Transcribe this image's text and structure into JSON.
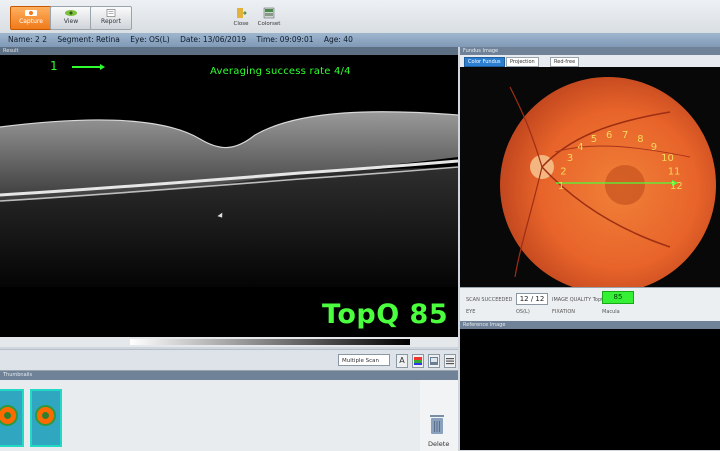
{
  "toolbar": {
    "capture_label": "Capture",
    "view_label": "View",
    "report_label": "Report",
    "close_label": "Close",
    "colorset_label": "Colorset"
  },
  "patient": {
    "name": "Name: 2 2",
    "segment": "Segment: Retina",
    "eye": "Eye: OS(L)",
    "date": "Date: 13/06/2019",
    "time": "Time: 09:09:01",
    "age": "Age: 40"
  },
  "oct": {
    "caption": "Result",
    "scan_index": "1",
    "averaging": "Averaging success rate  4/4",
    "topq": "TopQ 85"
  },
  "tools": {
    "scan_mode": "Multiple Scan",
    "text_tool": "A"
  },
  "thumbnails": {
    "caption": "Thumbnails",
    "delete_label": "Delete"
  },
  "fundus": {
    "caption": "Fundus Image",
    "tabs": [
      "Color Fundus",
      "Projection",
      "Red-free"
    ],
    "numbers": [
      "1",
      "2",
      "3",
      "4",
      "5",
      "6",
      "7",
      "8",
      "9",
      "10",
      "11",
      "12"
    ]
  },
  "quality": {
    "scan_succeeded_label": "SCAN SUCCEEDED",
    "scan_succeeded_value": "12 / 12",
    "image_quality_label": "IMAGE QUALITY TopQ",
    "image_quality_value": "85",
    "eye_label": "EYE",
    "eye_value": "OS(L)",
    "fixation_label": "FIXATION",
    "fixation_value": "Macula"
  },
  "reference": {
    "caption": "Reference Image"
  },
  "colors": {
    "accent_green": "#2fff2f",
    "fundus_orange": "#e8642a",
    "capture_orange": "#f07a1a"
  }
}
